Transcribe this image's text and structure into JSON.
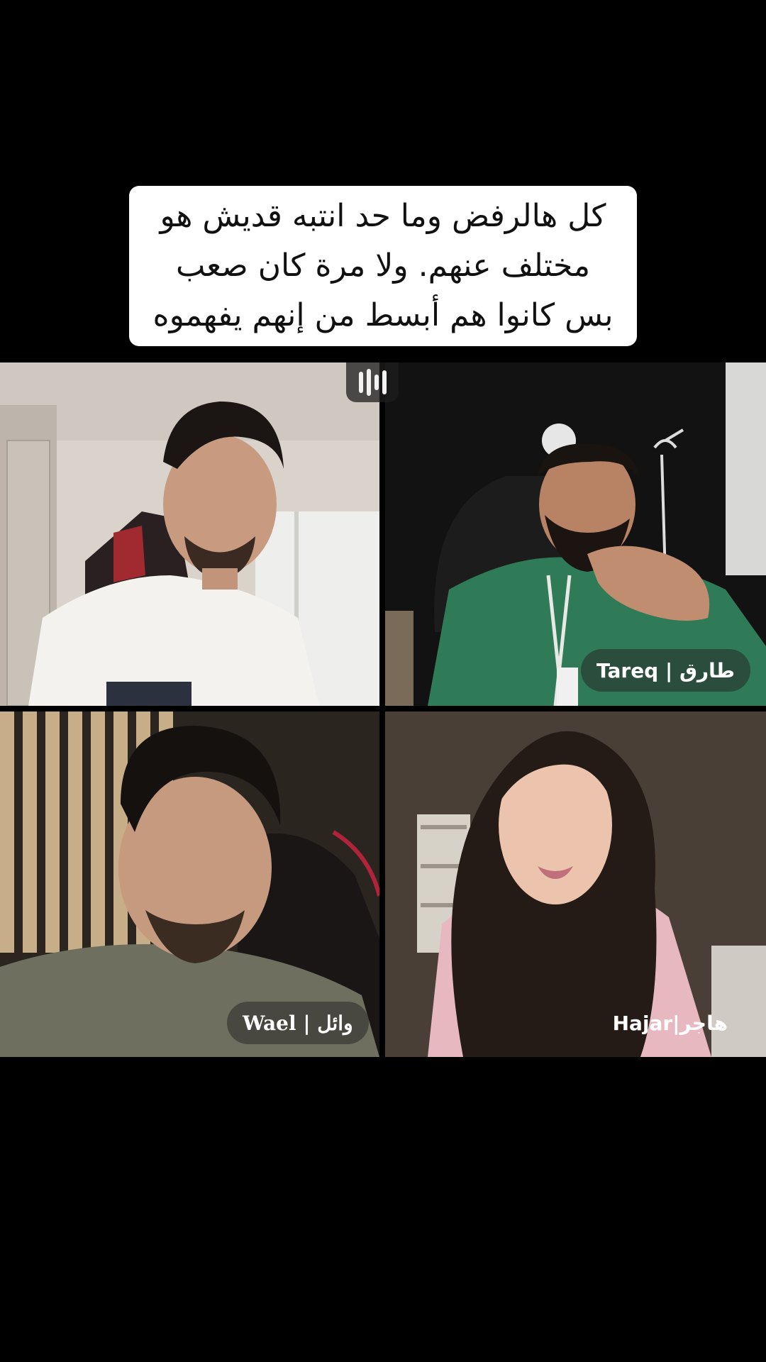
{
  "caption": {
    "lines": [
      "كل هالرفض وما حد انتبه قديش هو",
      "مختلف عنهم. ولا مرة كان صعب",
      "بس كانوا هم أبسط من إنهم يفهموه"
    ]
  },
  "participants": [
    {
      "id": "top-left",
      "name": ""
    },
    {
      "id": "top-right",
      "name": "Tareq | طارق"
    },
    {
      "id": "bottom-left",
      "name": "Wael | وائل"
    },
    {
      "id": "bottom-right",
      "name": "Hajar|هاجر"
    }
  ],
  "icons": {
    "recording": "audio-bars-icon"
  },
  "colors": {
    "background": "#000000",
    "caption_bg": "#ffffff",
    "caption_text": "#111111",
    "tareq_jacket": "#2f7a57"
  }
}
